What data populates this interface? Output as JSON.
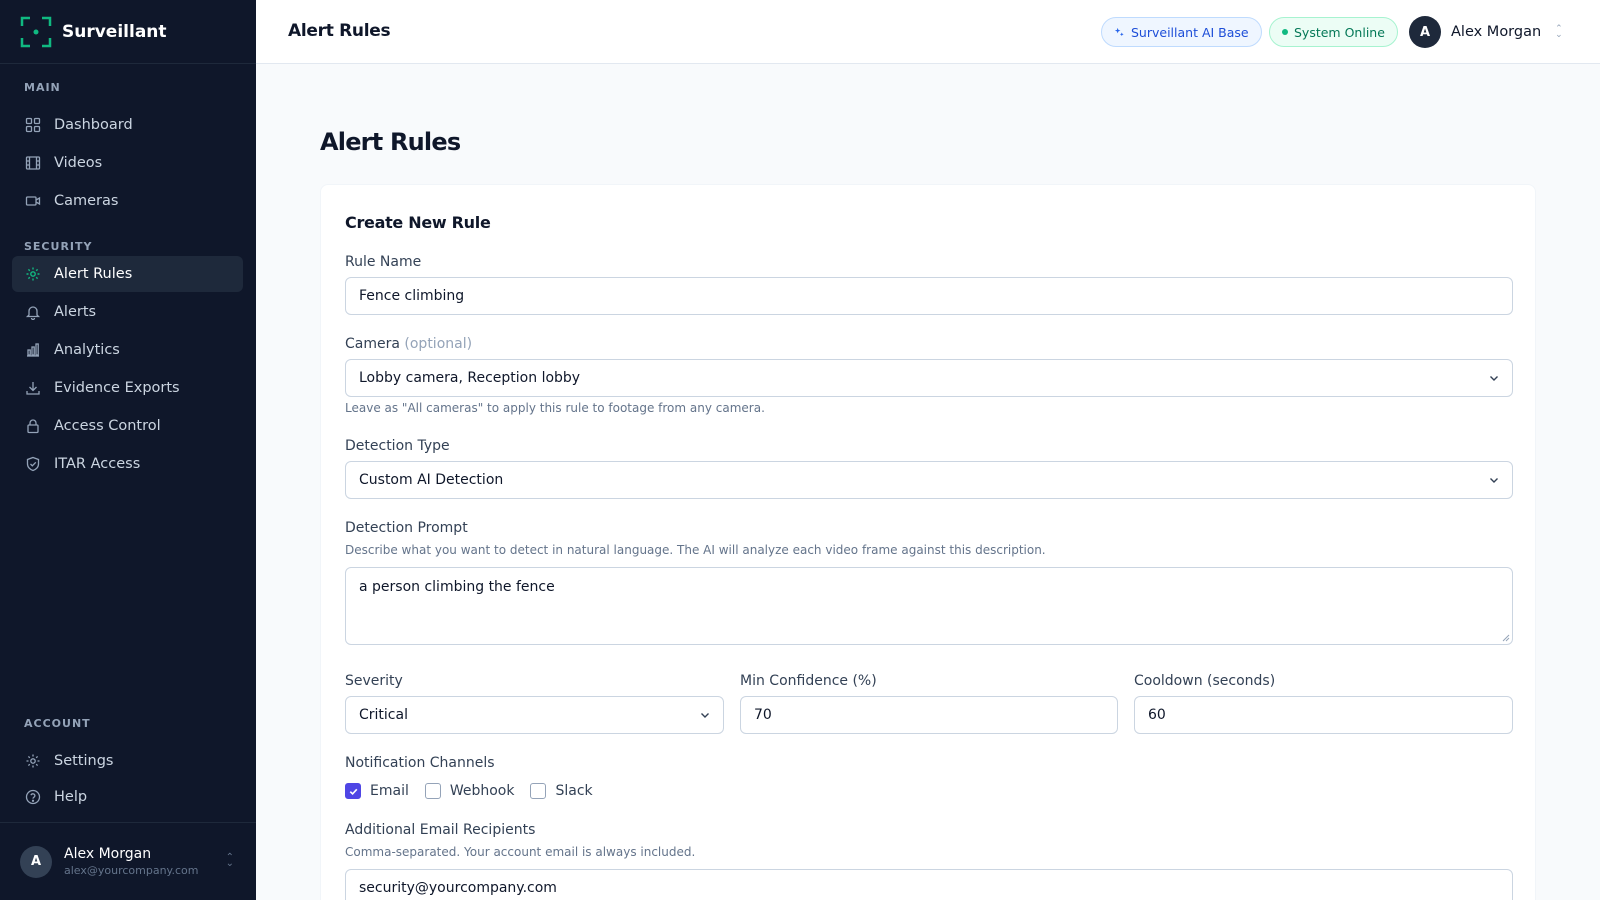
{
  "app": {
    "name": "Surveillant"
  },
  "sidebar": {
    "sections": {
      "main": "MAIN",
      "security": "SECURITY",
      "account": "ACCOUNT"
    },
    "items": [
      {
        "label": "Dashboard",
        "icon": "grid-icon"
      },
      {
        "label": "Videos",
        "icon": "film-icon"
      },
      {
        "label": "Cameras",
        "icon": "camera-icon"
      },
      {
        "label": "Alert Rules",
        "icon": "gear-icon",
        "active": true
      },
      {
        "label": "Alerts",
        "icon": "bell-icon"
      },
      {
        "label": "Analytics",
        "icon": "bar-chart-icon"
      },
      {
        "label": "Evidence Exports",
        "icon": "download-icon"
      },
      {
        "label": "Access Control",
        "icon": "lock-icon"
      },
      {
        "label": "ITAR Access",
        "icon": "shield-check-icon"
      },
      {
        "label": "Settings",
        "icon": "gear-icon"
      },
      {
        "label": "Help",
        "icon": "help-circle-icon"
      }
    ],
    "user": {
      "initial": "A",
      "name": "Alex Morgan",
      "email": "alex@yourcompany.com"
    }
  },
  "topbar": {
    "title": "Alert Rules",
    "ai_badge": "Surveillant AI Base",
    "status_badge": "System Online",
    "user": {
      "initial": "A",
      "name": "Alex Morgan"
    }
  },
  "page": {
    "title": "Alert Rules"
  },
  "form": {
    "title": "Create New Rule",
    "rule_name": {
      "label": "Rule Name",
      "value": "Fence climbing"
    },
    "camera": {
      "label": "Camera",
      "optional": "(optional)",
      "value": "Lobby camera, Reception lobby",
      "help": "Leave as \"All cameras\" to apply this rule to footage from any camera."
    },
    "detection_type": {
      "label": "Detection Type",
      "value": "Custom AI Detection"
    },
    "detection_prompt": {
      "label": "Detection Prompt",
      "help": "Describe what you want to detect in natural language. The AI will analyze each video frame against this description.",
      "value": "a person climbing the fence"
    },
    "severity": {
      "label": "Severity",
      "value": "Critical"
    },
    "min_confidence": {
      "label": "Min Confidence (%)",
      "value": "70"
    },
    "cooldown": {
      "label": "Cooldown (seconds)",
      "value": "60"
    },
    "channels": {
      "label": "Notification Channels",
      "email": "Email",
      "webhook": "Webhook",
      "slack": "Slack",
      "email_checked": true,
      "webhook_checked": false,
      "slack_checked": false
    },
    "recipients": {
      "label": "Additional Email Recipients",
      "help": "Comma-separated. Your account email is always included.",
      "value": "security@yourcompany.com"
    }
  },
  "colors": {
    "sidebar_bg": "#0f172a",
    "accent": "#10b981",
    "checkbox": "#4f46e5"
  }
}
